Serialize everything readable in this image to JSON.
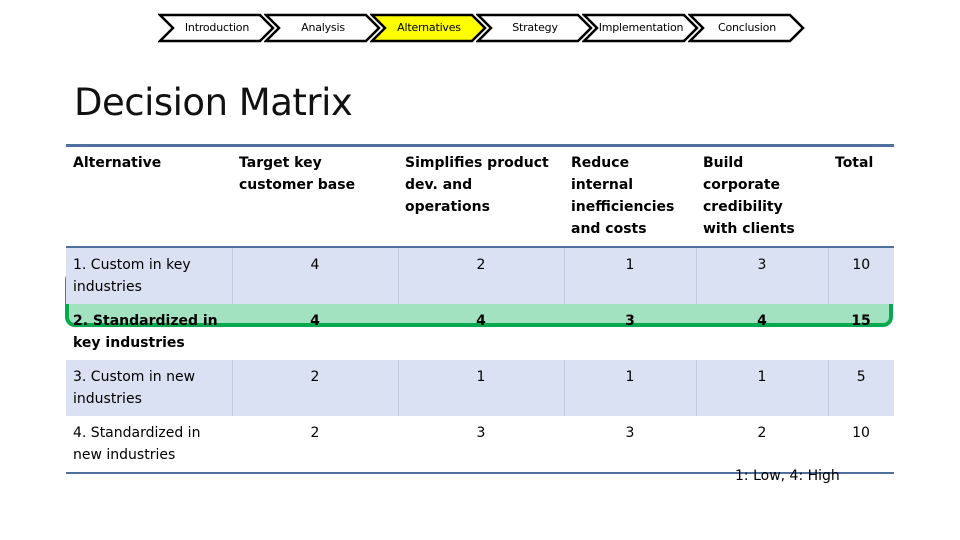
{
  "nav": {
    "steps": [
      {
        "label": "Introduction",
        "active": false
      },
      {
        "label": "Analysis",
        "active": false
      },
      {
        "label": "Alternatives",
        "active": true
      },
      {
        "label": "Strategy",
        "active": false
      },
      {
        "label": "Implementation",
        "active": false
      },
      {
        "label": "Conclusion",
        "active": false
      }
    ],
    "active_color": "#ffff00"
  },
  "page": {
    "title": "Decision Matrix",
    "legend": "1: Low, 4: High"
  },
  "table": {
    "headers": [
      "Alternative",
      "Target key customer base",
      "Simplifies product dev. and operations",
      "Reduce internal inefficiencies and costs",
      "Build corporate credibility with clients",
      "Total"
    ],
    "rows": [
      {
        "name": "1. Custom in key industries",
        "scores": [
          "4",
          "2",
          "1",
          "3"
        ],
        "total": "10",
        "highlighted": false
      },
      {
        "name": "2. Standardized in key industries",
        "scores": [
          "4",
          "4",
          "3",
          "4"
        ],
        "total": "15",
        "highlighted": true
      },
      {
        "name": "3. Custom in new industries",
        "scores": [
          "2",
          "1",
          "1",
          "1"
        ],
        "total": "5",
        "highlighted": false
      },
      {
        "name": "4. Standardized in new industries",
        "scores": [
          "2",
          "3",
          "3",
          "2"
        ],
        "total": "10",
        "highlighted": false
      }
    ],
    "highlight_color": "#a3e2c1",
    "highlight_border": "#08a84f",
    "band_color": "#d9e1f2"
  }
}
